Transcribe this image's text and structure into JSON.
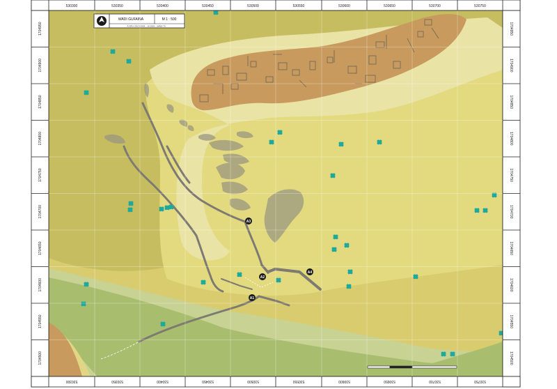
{
  "title_block": {
    "site_name": "WADI GUFAINA",
    "scale": "M 1 : 500",
    "subtitle": "A.OFH. DIV.3 DKM _ 10.2002 _ WADI 70"
  },
  "grid": {
    "x_labels": [
      "530300",
      "530350",
      "530400",
      "530450",
      "530500",
      "530550",
      "530600",
      "530650",
      "530700",
      "530750"
    ],
    "y_labels": [
      "1704500",
      "1704550",
      "1704600",
      "1704650",
      "1704700",
      "1704750",
      "1704800",
      "1704850",
      "1704900",
      "1704950"
    ],
    "y_labels_right": [
      "1704950",
      "1704900",
      "1704850",
      "1704800",
      "1704750",
      "1704700",
      "1704650",
      "1704600",
      "1704550",
      "1704500"
    ]
  },
  "sites": [
    {
      "id": "A1",
      "label": "A1"
    },
    {
      "id": "A2",
      "label": "A2"
    },
    {
      "id": "A3",
      "label": "A3"
    },
    {
      "id": "A4",
      "label": "A4"
    }
  ],
  "colors": {
    "lowland_green": "#a9bd6f",
    "pale_green": "#c6d295",
    "plain_yellow": "#e8dd85",
    "olive": "#c7be62",
    "light_yellow": "#ece5a8",
    "ridge_brown": "#c89a5d",
    "wall_gray": "#7d7a72",
    "frame": "#2a2a2a",
    "tree": "#1fa99c"
  }
}
